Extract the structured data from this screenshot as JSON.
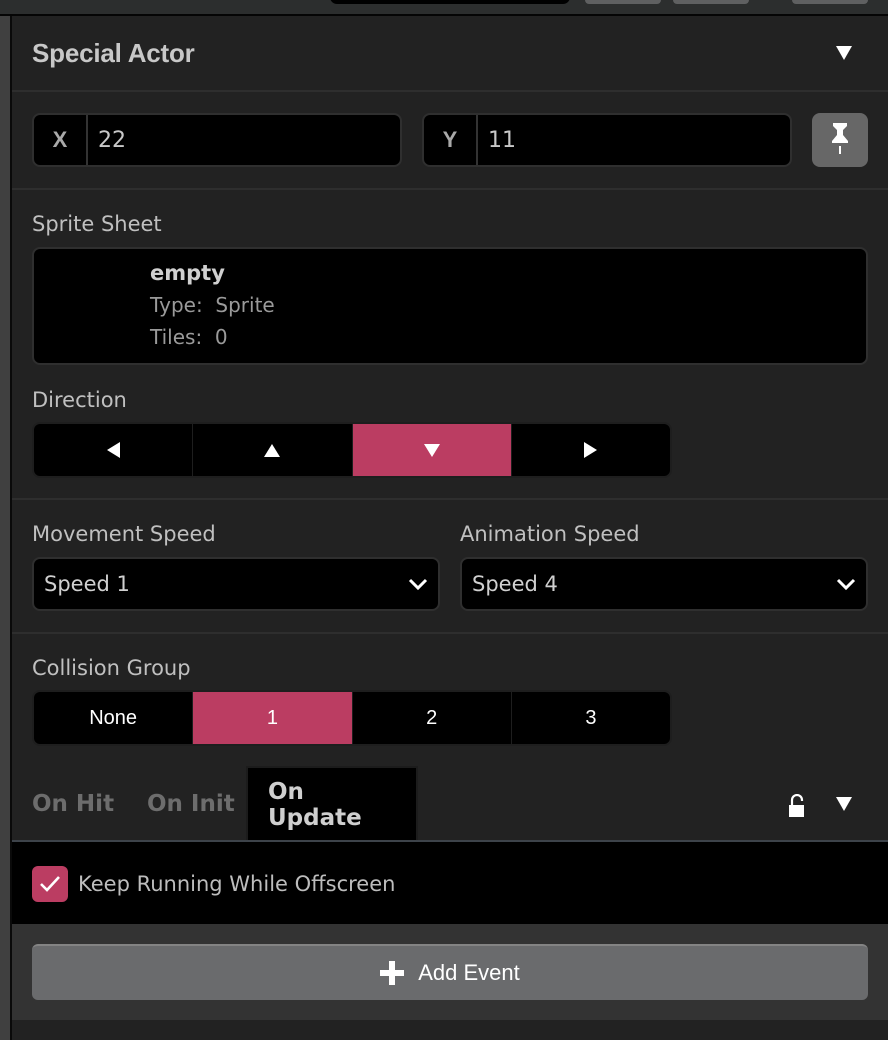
{
  "section": {
    "title": "Special Actor",
    "collapse_icon": "caret-down-icon"
  },
  "position": {
    "x_label": "X",
    "x_value": "22",
    "y_label": "Y",
    "y_value": "11",
    "pin_icon": "pushpin-icon"
  },
  "sprite_sheet": {
    "label": "Sprite Sheet",
    "name": "empty",
    "type_label": "Type:",
    "type_value": "Sprite",
    "tiles_label": "Tiles:",
    "tiles_value": "0"
  },
  "direction": {
    "label": "Direction",
    "options": [
      {
        "name": "left",
        "icon": "arrow-left-icon"
      },
      {
        "name": "up",
        "icon": "arrow-up-icon"
      },
      {
        "name": "down",
        "icon": "arrow-down-icon"
      },
      {
        "name": "right",
        "icon": "arrow-right-icon"
      }
    ],
    "selected": "down"
  },
  "movement_speed": {
    "label": "Movement Speed",
    "value": "Speed 1"
  },
  "animation_speed": {
    "label": "Animation Speed",
    "value": "Speed 4"
  },
  "collision_group": {
    "label": "Collision Group",
    "options": [
      "None",
      "1",
      "2",
      "3"
    ],
    "selected": "1"
  },
  "script_tabs": {
    "tabs": [
      "On Hit",
      "On Init",
      "On Update"
    ],
    "active": "On Update",
    "lock_icon": "unlock-icon",
    "collapse_icon": "caret-down-icon"
  },
  "on_update": {
    "keep_running_label": "Keep Running While Offscreen",
    "keep_running_checked": true
  },
  "add_event": {
    "label": "Add Event",
    "icon": "plus-icon"
  },
  "colors": {
    "accent": "#bb3d62",
    "panel_bg": "#222222",
    "field_bg": "#000000",
    "button_bg": "#6a6b6d"
  }
}
